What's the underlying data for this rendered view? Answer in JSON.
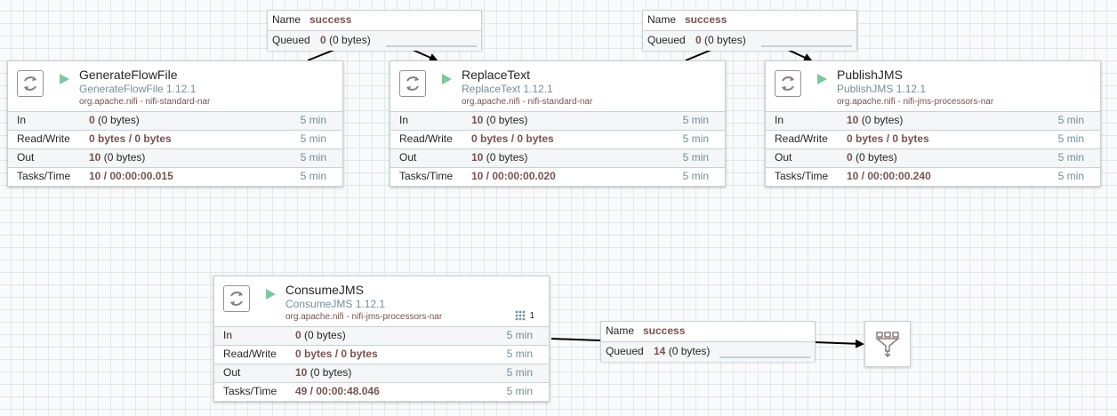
{
  "processors": [
    {
      "name": "GenerateFlowFile",
      "type": "GenerateFlowFile 1.12.1",
      "bundle": "org.apache.nifi - nifi-standard-nar",
      "stats": [
        {
          "label": "In",
          "value_bold": "0",
          "value_plain": " (0 bytes)",
          "time": "5 min"
        },
        {
          "label": "Read/Write",
          "value_bold": "0 bytes / 0 bytes",
          "value_plain": "",
          "time": "5 min"
        },
        {
          "label": "Out",
          "value_bold": "10",
          "value_plain": " (0 bytes)",
          "time": "5 min"
        },
        {
          "label": "Tasks/Time",
          "value_bold": "10 / 00:00:00.015",
          "value_plain": "",
          "time": "5 min"
        }
      ]
    },
    {
      "name": "ReplaceText",
      "type": "ReplaceText 1.12.1",
      "bundle": "org.apache.nifi - nifi-standard-nar",
      "stats": [
        {
          "label": "In",
          "value_bold": "10",
          "value_plain": " (0 bytes)",
          "time": "5 min"
        },
        {
          "label": "Read/Write",
          "value_bold": "0 bytes / 0 bytes",
          "value_plain": "",
          "time": "5 min"
        },
        {
          "label": "Out",
          "value_bold": "10",
          "value_plain": " (0 bytes)",
          "time": "5 min"
        },
        {
          "label": "Tasks/Time",
          "value_bold": "10 / 00:00:00.020",
          "value_plain": "",
          "time": "5 min"
        }
      ]
    },
    {
      "name": "PublishJMS",
      "type": "PublishJMS 1.12.1",
      "bundle": "org.apache.nifi - nifi-jms-processors-nar",
      "stats": [
        {
          "label": "In",
          "value_bold": "10",
          "value_plain": " (0 bytes)",
          "time": "5 min"
        },
        {
          "label": "Read/Write",
          "value_bold": "0 bytes / 0 bytes",
          "value_plain": "",
          "time": "5 min"
        },
        {
          "label": "Out",
          "value_bold": "0",
          "value_plain": " (0 bytes)",
          "time": "5 min"
        },
        {
          "label": "Tasks/Time",
          "value_bold": "10 / 00:00:00.240",
          "value_plain": "",
          "time": "5 min"
        }
      ]
    },
    {
      "name": "ConsumeJMS",
      "type": "ConsumeJMS 1.12.1",
      "bundle": "org.apache.nifi - nifi-jms-processors-nar",
      "badge_count": "1",
      "stats": [
        {
          "label": "In",
          "value_bold": "0",
          "value_plain": " (0 bytes)",
          "time": "5 min"
        },
        {
          "label": "Read/Write",
          "value_bold": "0 bytes / 0 bytes",
          "value_plain": "",
          "time": "5 min"
        },
        {
          "label": "Out",
          "value_bold": "10",
          "value_plain": " (0 bytes)",
          "time": "5 min"
        },
        {
          "label": "Tasks/Time",
          "value_bold": "49 / 00:00:48.046",
          "value_plain": "",
          "time": "5 min"
        }
      ]
    }
  ],
  "connections": [
    {
      "name_label": "Name",
      "name": "success",
      "queued_label": "Queued",
      "queued_count": "0",
      "queued_bytes": " (0 bytes)"
    },
    {
      "name_label": "Name",
      "name": "success",
      "queued_label": "Queued",
      "queued_count": "0",
      "queued_bytes": " (0 bytes)"
    },
    {
      "name_label": "Name",
      "name": "success",
      "queued_label": "Queued",
      "queued_count": "14",
      "queued_bytes": " (0 bytes)"
    }
  ],
  "funnel": {
    "icon": "funnel-icon"
  },
  "colors": {
    "canvas": "#f9fafb",
    "grid": "#e3e8eb",
    "border": "#c7d2d7",
    "run_green": "#7dc7a0",
    "type_blue": "#728e9b",
    "value_brown": "#775351"
  }
}
